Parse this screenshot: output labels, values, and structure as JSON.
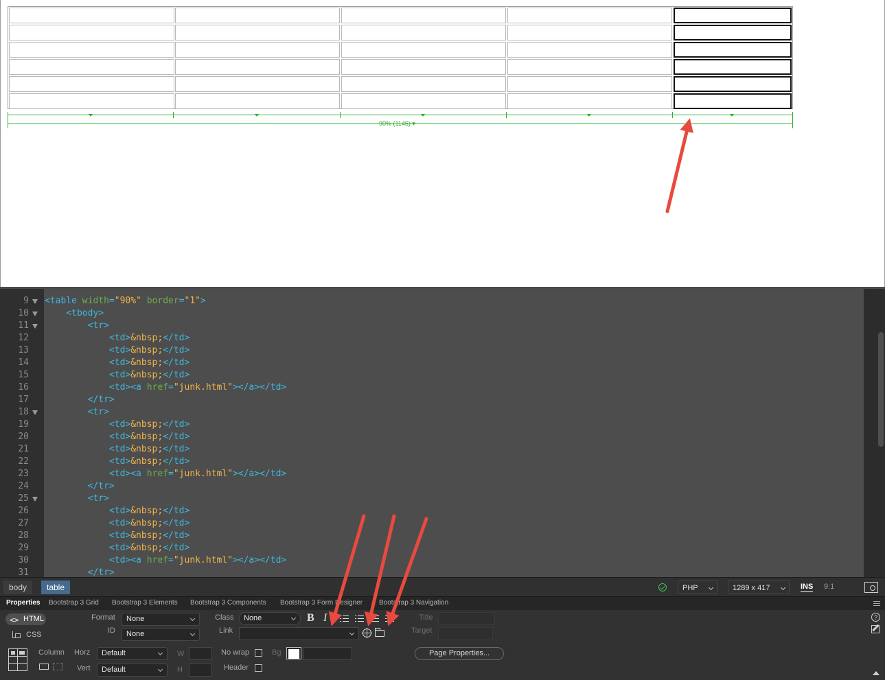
{
  "design": {
    "ruler_label": "90% (1145) ▾"
  },
  "code": {
    "lines": [
      {
        "n": "9",
        "fold": true,
        "html": "<span class='tg'>&lt;table</span> <span class='at'>width</span><span class='tg'>=</span><span class='st'>\"90%\"</span> <span class='at'>border</span><span class='tg'>=</span><span class='st'>\"1\"</span><span class='tg'>&gt;</span>"
      },
      {
        "n": "10",
        "fold": true,
        "html": "    <span class='tg'>&lt;tbody&gt;</span>"
      },
      {
        "n": "11",
        "fold": true,
        "html": "        <span class='tg'>&lt;tr&gt;</span>"
      },
      {
        "n": "12",
        "fold": false,
        "html": "            <span class='tg'>&lt;td&gt;</span><span class='en'>&amp;nbsp;</span><span class='tg'>&lt;/td&gt;</span>"
      },
      {
        "n": "13",
        "fold": false,
        "html": "            <span class='tg'>&lt;td&gt;</span><span class='en'>&amp;nbsp;</span><span class='tg'>&lt;/td&gt;</span>"
      },
      {
        "n": "14",
        "fold": false,
        "html": "            <span class='tg'>&lt;td&gt;</span><span class='en'>&amp;nbsp;</span><span class='tg'>&lt;/td&gt;</span>"
      },
      {
        "n": "15",
        "fold": false,
        "html": "            <span class='tg'>&lt;td&gt;</span><span class='en'>&amp;nbsp;</span><span class='tg'>&lt;/td&gt;</span>"
      },
      {
        "n": "16",
        "fold": false,
        "html": "            <span class='tg'>&lt;td&gt;&lt;a</span> <span class='at'>href</span><span class='tg'>=</span><span class='st'>\"junk.html\"</span><span class='tg'>&gt;&lt;/a&gt;&lt;/td&gt;</span>"
      },
      {
        "n": "17",
        "fold": false,
        "html": "        <span class='tg'>&lt;/tr&gt;</span>"
      },
      {
        "n": "18",
        "fold": true,
        "html": "        <span class='tg'>&lt;tr&gt;</span>"
      },
      {
        "n": "19",
        "fold": false,
        "html": "            <span class='tg'>&lt;td&gt;</span><span class='en'>&amp;nbsp;</span><span class='tg'>&lt;/td&gt;</span>"
      },
      {
        "n": "20",
        "fold": false,
        "html": "            <span class='tg'>&lt;td&gt;</span><span class='en'>&amp;nbsp;</span><span class='tg'>&lt;/td&gt;</span>"
      },
      {
        "n": "21",
        "fold": false,
        "html": "            <span class='tg'>&lt;td&gt;</span><span class='en'>&amp;nbsp;</span><span class='tg'>&lt;/td&gt;</span>"
      },
      {
        "n": "22",
        "fold": false,
        "html": "            <span class='tg'>&lt;td&gt;</span><span class='en'>&amp;nbsp;</span><span class='tg'>&lt;/td&gt;</span>"
      },
      {
        "n": "23",
        "fold": false,
        "html": "            <span class='tg'>&lt;td&gt;&lt;a</span> <span class='at'>href</span><span class='tg'>=</span><span class='st'>\"junk.html\"</span><span class='tg'>&gt;&lt;/a&gt;&lt;/td&gt;</span>"
      },
      {
        "n": "24",
        "fold": false,
        "html": "        <span class='tg'>&lt;/tr&gt;</span>"
      },
      {
        "n": "25",
        "fold": true,
        "html": "        <span class='tg'>&lt;tr&gt;</span>"
      },
      {
        "n": "26",
        "fold": false,
        "html": "            <span class='tg'>&lt;td&gt;</span><span class='en'>&amp;nbsp;</span><span class='tg'>&lt;/td&gt;</span>"
      },
      {
        "n": "27",
        "fold": false,
        "html": "            <span class='tg'>&lt;td&gt;</span><span class='en'>&amp;nbsp;</span><span class='tg'>&lt;/td&gt;</span>"
      },
      {
        "n": "28",
        "fold": false,
        "html": "            <span class='tg'>&lt;td&gt;</span><span class='en'>&amp;nbsp;</span><span class='tg'>&lt;/td&gt;</span>"
      },
      {
        "n": "29",
        "fold": false,
        "html": "            <span class='tg'>&lt;td&gt;</span><span class='en'>&amp;nbsp;</span><span class='tg'>&lt;/td&gt;</span>"
      },
      {
        "n": "30",
        "fold": false,
        "html": "            <span class='tg'>&lt;td&gt;&lt;a</span> <span class='at'>href</span><span class='tg'>=</span><span class='st'>\"junk.html\"</span><span class='tg'>&gt;&lt;/a&gt;&lt;/td&gt;</span>"
      },
      {
        "n": "31",
        "fold": false,
        "html": "        <span class='tg'>&lt;/tr&gt;</span>"
      }
    ]
  },
  "status": {
    "crumbs": [
      "body",
      "table"
    ],
    "doc_type": "PHP",
    "window_size": "1289 x 417",
    "mode": "INS",
    "cursor": "9:1"
  },
  "tabs": [
    "Properties",
    "Bootstrap 3 Grid",
    "Bootstrap 3 Elements",
    "Bootstrap 3 Components",
    "Bootstrap 3 Form Designer",
    "Bootstrap 3 Navigation"
  ],
  "props": {
    "html_label": "HTML",
    "css_label": "CSS",
    "format_label": "Format",
    "format_value": "None",
    "id_label": "ID",
    "id_value": "None",
    "class_label": "Class",
    "class_value": "None",
    "link_label": "Link",
    "link_value": "",
    "title_label": "Title",
    "target_label": "Target",
    "column_label": "Column",
    "horz_label": "Horz",
    "horz_value": "Default",
    "vert_label": "Vert",
    "vert_value": "Default",
    "w_label": "W",
    "h_label": "H",
    "nowrap_label": "No wrap",
    "header_label": "Header",
    "bg_label": "Bg",
    "page_props_label": "Page Properties..."
  },
  "colors": {
    "annotation_arrow": "#e84a3f",
    "selected_crumb": "#456a8e",
    "ruler": "#2fb02f"
  }
}
